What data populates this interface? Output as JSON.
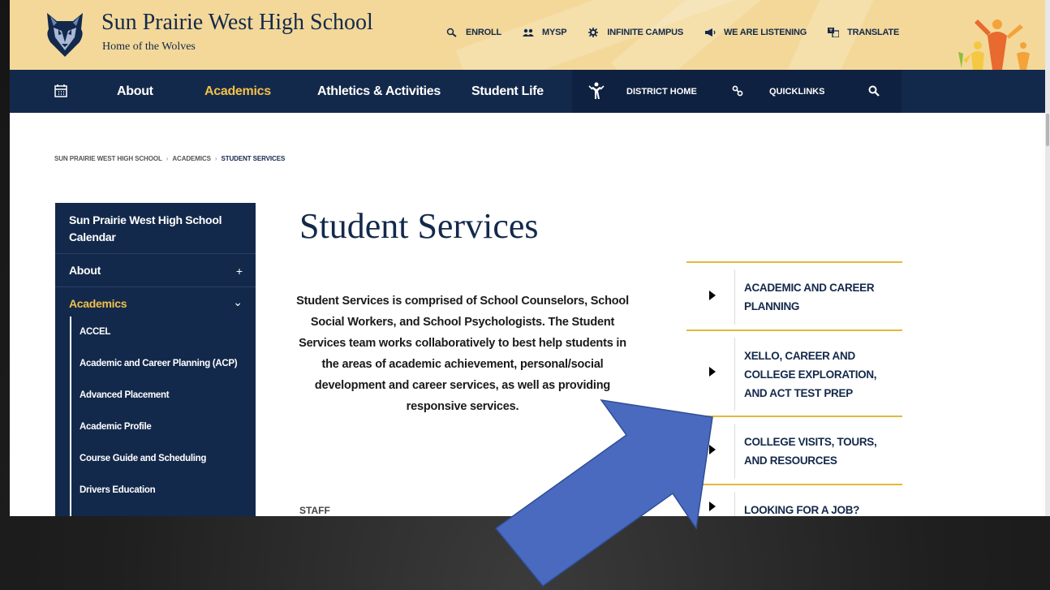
{
  "header": {
    "school_name": "Sun Prairie West High School",
    "tagline": "Home of the Wolves",
    "utility_links": [
      {
        "label": "ENROLL",
        "icon": "enroll-icon"
      },
      {
        "label": "MYSP",
        "icon": "users-icon"
      },
      {
        "label": "INFINITE CAMPUS",
        "icon": "gear-icon"
      },
      {
        "label": "WE ARE LISTENING",
        "icon": "megaphone-icon"
      },
      {
        "label": "TRANSLATE",
        "icon": "translate-icon"
      }
    ],
    "colors": {
      "background": "#f3d899",
      "navy": "#13294b",
      "gold": "#f3c04a"
    }
  },
  "nav": {
    "items": [
      {
        "label": "About"
      },
      {
        "label": "Academics",
        "active": true
      },
      {
        "label": "Athletics & Activities"
      },
      {
        "label": "Student Life"
      }
    ],
    "district_home": "DISTRICT HOME",
    "quicklinks": "QUICKLINKS"
  },
  "breadcrumb": {
    "items": [
      "SUN PRAIRIE WEST HIGH SCHOOL",
      "ACADEMICS",
      "STUDENT SERVICES"
    ]
  },
  "sidebar": {
    "calendar": "Sun Prairie West High School Calendar",
    "about": "About",
    "about_toggle": "+",
    "academics": "Academics",
    "academics_toggle": "⌄",
    "sub_items": [
      "ACCEL",
      "Academic and Career Planning (ACP)",
      "Advanced Placement",
      "Academic Profile",
      "Course Guide and Scheduling",
      "Drivers Education"
    ]
  },
  "main": {
    "title": "Student Services",
    "intro": "Student Services is comprised of School Counselors, School Social Workers, and  School Psychologists. The Student Services team works collaboratively to best help students in the areas of academic achievement, personal/social development and career services, as well as providing responsive services.",
    "staff_label": "STAFF"
  },
  "accordion": {
    "items": [
      "ACADEMIC AND CAREER PLANNING",
      "XELLO, CAREER AND COLLEGE EXPLORATION, AND ACT TEST PREP",
      "COLLEGE VISITS, TOURS, AND RESOURCES",
      "LOOKING FOR A JOB?"
    ],
    "border_color": "#e3b93b"
  },
  "overlay": {
    "arrow_color": "#4a6abf",
    "arrow_points_to": "COLLEGE VISITS, TOURS, AND RESOURCES"
  }
}
